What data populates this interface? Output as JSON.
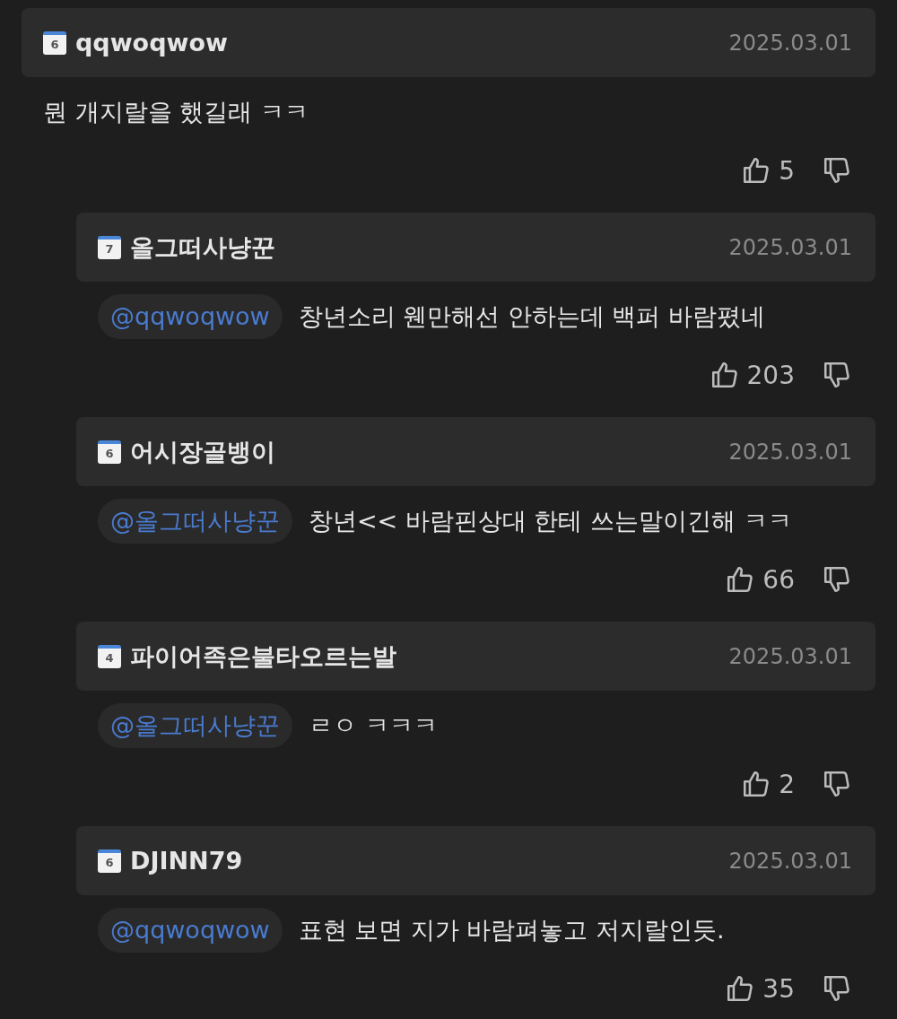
{
  "comments": [
    {
      "user": "qqwoqwow",
      "badge": "6",
      "date": "2025.03.01",
      "reply": false,
      "text": "뭔 개지랄을 했길래 ㅋㅋ",
      "likes": "5"
    },
    {
      "user": "올그떠사냥꾼",
      "badge": "7",
      "date": "2025.03.01",
      "reply": true,
      "mention": "@qqwoqwow",
      "text": "창년소리 웬만해선 안하는데 백퍼 바람폈네",
      "likes": "203"
    },
    {
      "user": "어시장골뱅이",
      "badge": "6",
      "date": "2025.03.01",
      "reply": true,
      "mention": "@올그떠사냥꾼",
      "text": "창년<< 바람핀상대 한테 쓰는말이긴해 ㅋㅋ",
      "likes": "66"
    },
    {
      "user": "파이어족은불타오르는발",
      "badge": "4",
      "date": "2025.03.01",
      "reply": true,
      "mention": "@올그떠사냥꾼",
      "text": "ㄹㅇ ㅋㅋㅋ",
      "likes": "2"
    },
    {
      "user": "DJINN79",
      "badge": "6",
      "date": "2025.03.01",
      "reply": true,
      "mention": "@qqwoqwow",
      "text": "표현 보면 지가 바람펴놓고 저지랄인듯.",
      "likes": "35"
    }
  ]
}
